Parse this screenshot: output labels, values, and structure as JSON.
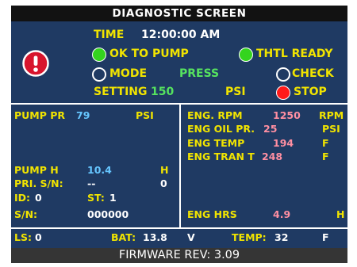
{
  "header": {
    "title": "DIAGNOSTIC SCREEN"
  },
  "status": {
    "time_label": "TIME",
    "time_value": "12:00:00 AM",
    "ok_to_pump": "OK TO PUMP",
    "thtl_ready": "THTL READY",
    "mode_label": "MODE",
    "mode_value": "PRESS",
    "check": "CHECK",
    "setting_label": "SETTING",
    "setting_value": "150",
    "setting_unit": "PSI",
    "stop": "STOP"
  },
  "left_panel": {
    "pump_pr_label": "PUMP PR",
    "pump_pr_value": "79",
    "pump_pr_unit": "PSI",
    "pump_h_label": "PUMP H",
    "pump_h_value": "10.4",
    "pump_h_unit": "H",
    "pri_sn_label": "PRI. S/N:",
    "pri_sn_value": "--",
    "pri_sn_count": "0",
    "id_label": "ID:",
    "id_value": "0",
    "st_label": "ST:",
    "st_value": "1",
    "sn_label": "S/N:",
    "sn_value": "000000"
  },
  "right_panel": {
    "eng_rpm_label": "ENG. RPM",
    "eng_rpm_value": "1250",
    "eng_rpm_unit": "RPM",
    "eng_oil_label": "ENG OIL PR.",
    "eng_oil_value": "25",
    "eng_oil_unit": "PSI",
    "eng_temp_label": "ENG TEMP",
    "eng_temp_value": "194",
    "eng_temp_unit": "F",
    "eng_tran_label": "ENG TRAN T",
    "eng_tran_value": "248",
    "eng_tran_unit": "F",
    "eng_hrs_label": "ENG HRS",
    "eng_hrs_value": "4.9",
    "eng_hrs_unit": "H"
  },
  "bottom_bar": {
    "ls_label": "LS:",
    "ls_value": "0",
    "bat_label": "BAT:",
    "bat_value": "13.8",
    "bat_unit": "V",
    "temp_label": "TEMP:",
    "temp_value": "32",
    "temp_unit": "F"
  },
  "footer": {
    "firmware": "FIRMWARE REV:  3.09"
  },
  "colors": {
    "background": "#1f3a63",
    "label_yellow": "#f1e400",
    "value_pink": "#ff8fa2",
    "value_blue": "#66c6ff",
    "value_green": "#56e35f",
    "indicator_green": "#34d41e",
    "indicator_red": "#ff1a1a",
    "alert_red": "#d8152d"
  },
  "icons": {
    "alert": "exclamation-circle-icon",
    "ok_to_pump": "green-indicator-dot",
    "thtl_ready": "green-indicator-dot",
    "mode": "empty-indicator-circle",
    "check": "empty-indicator-circle",
    "stop": "red-indicator-dot"
  }
}
